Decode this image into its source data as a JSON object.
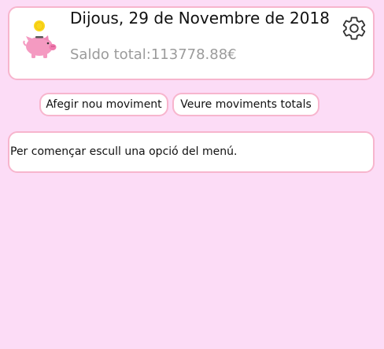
{
  "header": {
    "date": "Dijous, 29 de Novembre de 2018",
    "balance": "Saldo total:113778.88€"
  },
  "actions": {
    "add_movement": "Afegir nou moviment",
    "view_movements": "Veure moviments totals"
  },
  "message": "Per començar escull una opció del menú.",
  "icons": {
    "logo": "piggy-bank-icon",
    "settings": "gear-icon"
  },
  "colors": {
    "background": "#fcdcf6",
    "border": "#f7b5cd",
    "pig": "#f49ac1",
    "coin": "#f9d71c",
    "balance_text": "#9b9b9b"
  }
}
